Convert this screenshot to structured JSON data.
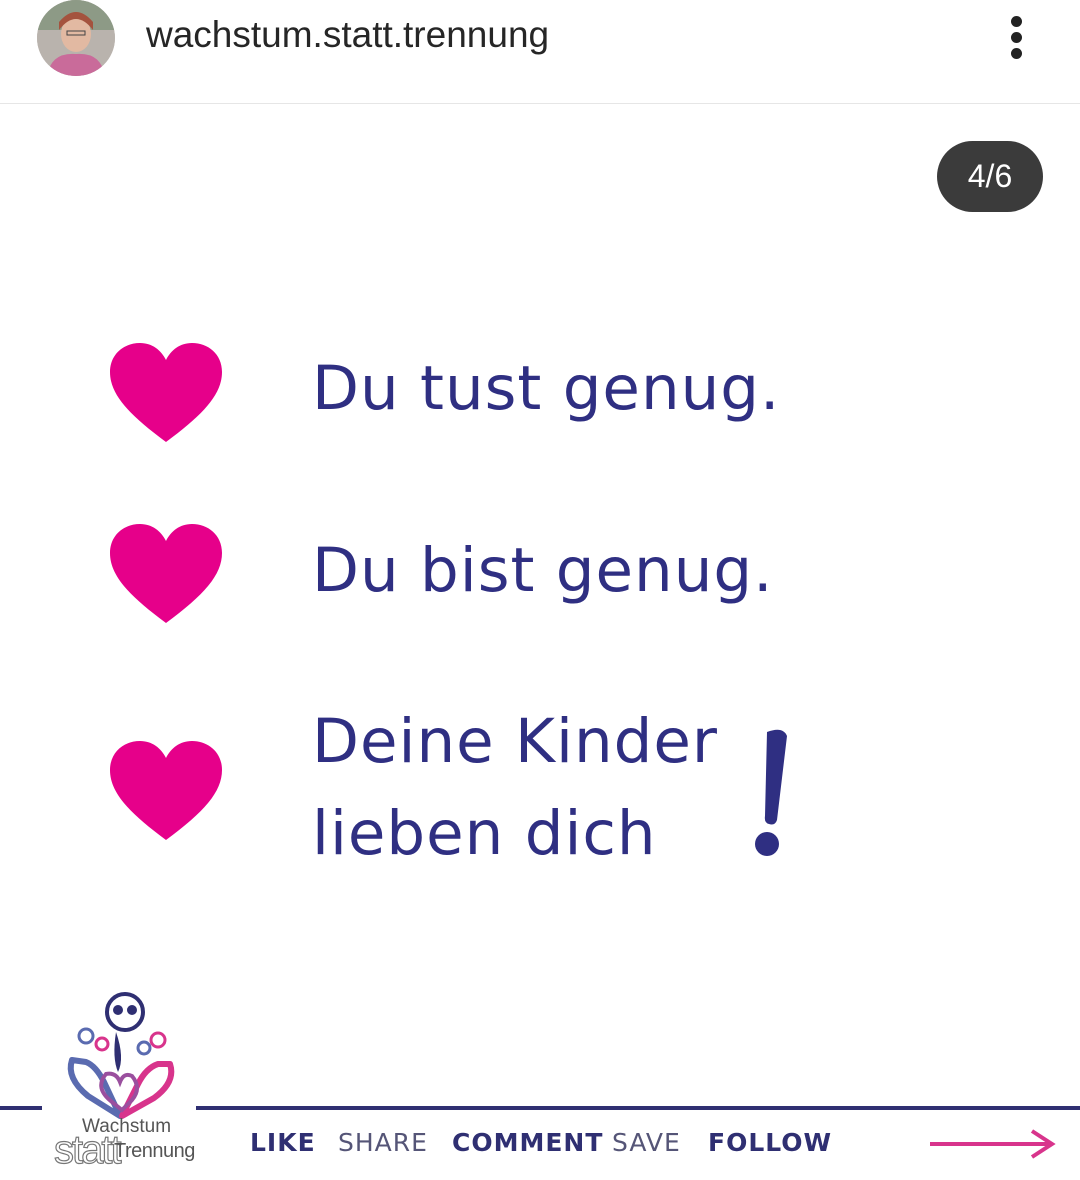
{
  "header": {
    "username": "wachstum.statt.trennung",
    "avatar_icon": "profile-photo",
    "more_icon": "more-vertical-icon"
  },
  "post": {
    "slide_counter": "4/6",
    "lines": [
      {
        "icon": "heart-icon",
        "text": [
          "Du tust genug."
        ]
      },
      {
        "icon": "heart-icon",
        "text": [
          "Du bist genug."
        ]
      },
      {
        "icon": "heart-icon",
        "text": [
          "Deine Kinder",
          "lieben dich"
        ],
        "suffix": "!"
      }
    ],
    "accent_color": "#e6008a",
    "text_color": "#2f2f82"
  },
  "logo": {
    "line1": "Wachstum",
    "line2a": "statt",
    "line2b": "Trennung"
  },
  "actions": {
    "like": "LIKE",
    "share": "SHARE",
    "comment": "COMMENT",
    "save": "SAVE",
    "follow": "FOLLOW",
    "next_icon": "arrow-right-icon"
  }
}
